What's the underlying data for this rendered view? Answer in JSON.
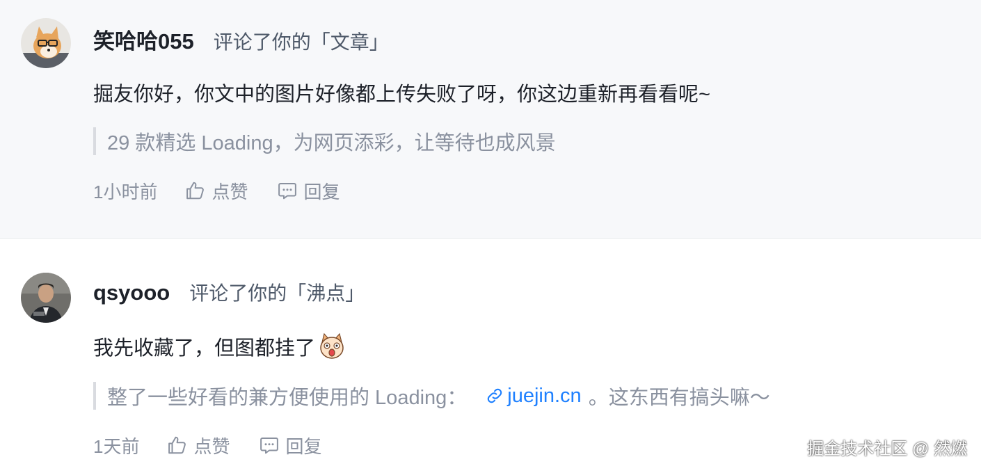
{
  "notifications": [
    {
      "username": "笑哈哈055",
      "action": "评论了你的「文章」",
      "content": "掘友你好，你文中的图片好像都上传失败了呀，你这边重新再看看呢~",
      "quote": "29 款精选 Loading，为网页添彩，让等待也成风景",
      "time": "1小时前",
      "like_label": "点赞",
      "reply_label": "回复",
      "avatar_icon": "shiba-dog-avatar"
    },
    {
      "username": "qsyooo",
      "action": "评论了你的「沸点」",
      "content": "我先收藏了，但图都挂了",
      "content_emoji": "shocked-dog-emoji",
      "quote_prefix": "整了一些好看的兼方便使用的 Loading：",
      "quote_link": "juejin.cn",
      "quote_suffix": "。这东西有搞头嘛～",
      "time": "1天前",
      "like_label": "点赞",
      "reply_label": "回复",
      "avatar_icon": "man-photo-avatar"
    }
  ],
  "watermark": "掘金技术社区 @ 然燃",
  "colors": {
    "link": "#1e80ff",
    "muted": "#8a919f",
    "text": "#1d2129",
    "highlight_bg": "#f7f8fa"
  }
}
